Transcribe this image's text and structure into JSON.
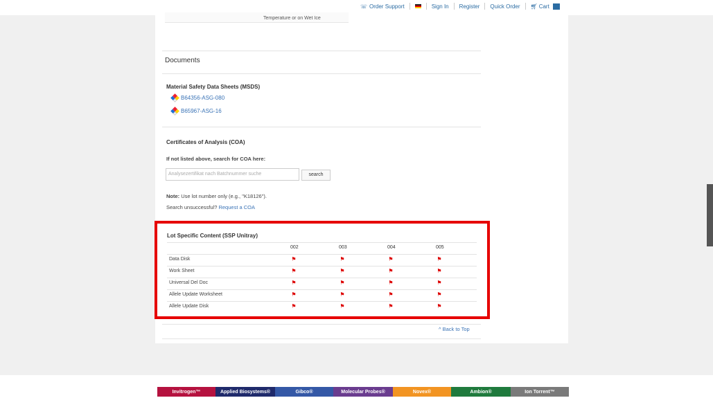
{
  "topbar": {
    "order_support": "Order Support",
    "sign_in": "Sign In",
    "register": "Register",
    "quick_order": "Quick Order",
    "cart": "Cart",
    "cart_count": "0"
  },
  "temperature_text": "Temperature or on Wet Ice",
  "documents": {
    "title": "Documents",
    "msds_title": "Material Safety Data Sheets (MSDS)",
    "msds_links": [
      "B64356-ASG-080",
      "B65967-ASG-16"
    ],
    "coa_title": "Certificates of Analysis (COA)",
    "coa_search_label": "If not listed above, search for COA here:",
    "coa_search_placeholder": "Analysezertifikat nach Batchnummer suche",
    "coa_search_button": "search",
    "note_label": "Note:",
    "note_text": " Use lot number only (e.g., \"K18126\").",
    "unsuccessful_text": "Search unsuccessful? ",
    "request_link": "Request a COA"
  },
  "lot_content": {
    "title": "Lot Specific Content (SSP Unitray)",
    "columns": [
      "002",
      "003",
      "004",
      "005"
    ],
    "rows": [
      "Data Disk",
      "Work Sheet",
      "Universal Del Doc",
      "Allele Update Worksheet",
      "Allele Update Disk"
    ]
  },
  "back_to_top": "^ Back to Top",
  "brands": [
    {
      "name": "Invitrogen™",
      "color": "#b5123f"
    },
    {
      "name": "Applied Biosystems®",
      "color": "#1f2a6b"
    },
    {
      "name": "Gibco®",
      "color": "#3458a6"
    },
    {
      "name": "Molecular Probes®",
      "color": "#6a3c8f"
    },
    {
      "name": "Novex®",
      "color": "#f29422"
    },
    {
      "name": "Ambion®",
      "color": "#1f7a3d"
    },
    {
      "name": "Ion Torrent™",
      "color": "#7a7a7a"
    }
  ]
}
